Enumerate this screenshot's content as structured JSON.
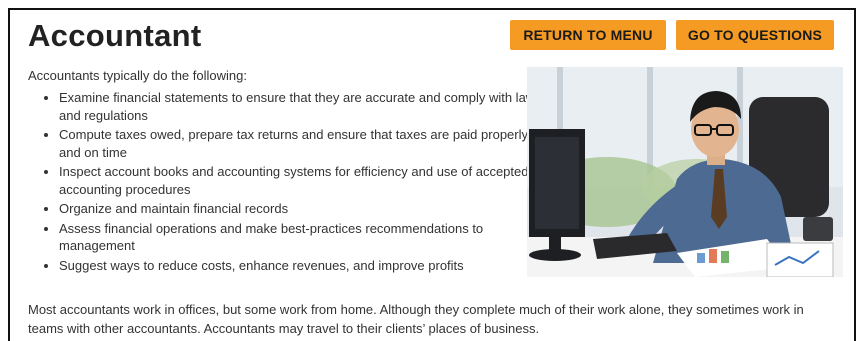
{
  "page": {
    "title": "Accountant",
    "buttons": {
      "return_label": "RETURN TO MENU",
      "questions_label": "GO TO QUESTIONS"
    },
    "accent_color": "#f59b23"
  },
  "content": {
    "intro": "Accountants typically do the following:",
    "duties": [
      "Examine financial statements to ensure that they are accurate and comply with laws and regulations",
      "Compute taxes owed, prepare tax returns and ensure that taxes are paid properly and on time",
      "Inspect account books and accounting systems for efficiency and use of accepted accounting procedures",
      "Organize and maintain financial records",
      "Assess financial operations and make best-practices recommendations to management",
      "Suggest ways to reduce costs, enhance revenues, and improve profits"
    ],
    "outro": "Most accountants work in offices, but some work from home. Although they complete much of their work alone, they sometimes work in teams with other accountants. Accountants may travel to their clients’ places of business."
  },
  "photo": {
    "icon": "accountant-photo"
  }
}
